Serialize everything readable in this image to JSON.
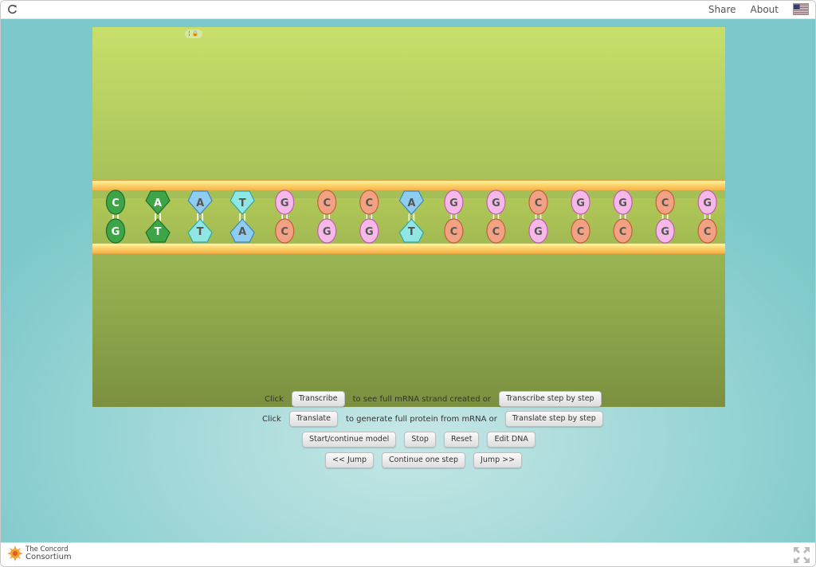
{
  "topbar": {
    "share_label": "Share",
    "about_label": "About",
    "reload_icon": "reload-icon",
    "flag_icon": "us-flag-icon"
  },
  "model": {
    "top_strand": [
      "C",
      "A",
      "A",
      "T",
      "G",
      "C",
      "C",
      "A",
      "G",
      "G",
      "C",
      "G",
      "G",
      "C",
      "G"
    ],
    "bottom_strand": [
      "G",
      "T",
      "T",
      "A",
      "C",
      "G",
      "G",
      "T",
      "C",
      "C",
      "G",
      "C",
      "C",
      "G",
      "C"
    ],
    "colors": {
      "A_top": "#3fa54a",
      "C": "#f29a7c",
      "G": "#f4b6e6",
      "A": "#8ed0f2",
      "T": "#8ee7e4",
      "C_dark": "#3fa54a"
    }
  },
  "controls": {
    "row1": {
      "click": "Click",
      "transcribe": "Transcribe",
      "mid": "to see full mRNA strand created or",
      "transcribe_step": "Transcribe step by step"
    },
    "row2": {
      "click": "Click",
      "translate": "Translate",
      "mid": "to generate full protein from mRNA or",
      "translate_step": "Translate step by step"
    },
    "row3": {
      "start": "Start/continue model",
      "stop": "Stop",
      "reset": "Reset",
      "edit": "Edit DNA"
    },
    "row4": {
      "jump_back": "<< Jump",
      "continue_one": "Continue one step",
      "jump_fwd": "Jump >>"
    }
  },
  "footer": {
    "logo_line1": "The Concord",
    "logo_line2": "Consortium"
  }
}
